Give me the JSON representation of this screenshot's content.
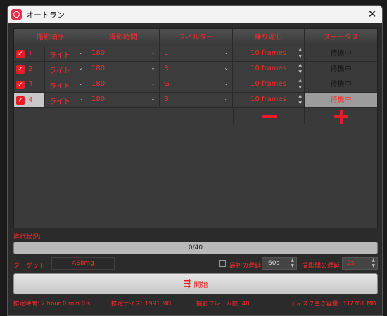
{
  "window": {
    "title": "オートラン"
  },
  "table": {
    "headers": [
      "撮影順序",
      "撮影時間",
      "フィルター",
      "繰り返し",
      "ステータス"
    ],
    "rows": [
      {
        "checked": true,
        "index": "1",
        "mode": "ライト",
        "time": "180",
        "filter": "L",
        "repeat": "10 frames",
        "status": "待機中",
        "selected": false
      },
      {
        "checked": true,
        "index": "2",
        "mode": "ライト",
        "time": "180",
        "filter": "R",
        "repeat": "10 frames",
        "status": "待機中",
        "selected": false
      },
      {
        "checked": true,
        "index": "3",
        "mode": "ライト",
        "time": "180",
        "filter": "G",
        "repeat": "10 frames",
        "status": "待機中",
        "selected": false
      },
      {
        "checked": true,
        "index": "4",
        "mode": "ライト",
        "time": "180",
        "filter": "B",
        "repeat": "10 frames",
        "status": "待機中",
        "selected": true
      }
    ]
  },
  "progress": {
    "label": "進行状況:",
    "text": "0/40",
    "value": 0
  },
  "target": {
    "label": "ターゲット:",
    "value": "ASIImg"
  },
  "delay": {
    "label": "最初の遅延:",
    "value": "60s",
    "checked": false
  },
  "interval": {
    "label": "撮影間の遅延",
    "value": "2s"
  },
  "start": {
    "label": "開始"
  },
  "footer": {
    "est_time": "推定時間:    2 hour 0 min 0 s",
    "est_size": "推定サイズ:    1991 MB",
    "frames": "撮影フレーム数:    40",
    "disk": "ディスク空き容量:    337781 MB"
  },
  "colors": {
    "accent": "#e81c24",
    "text_red": "#ff2a2a"
  }
}
